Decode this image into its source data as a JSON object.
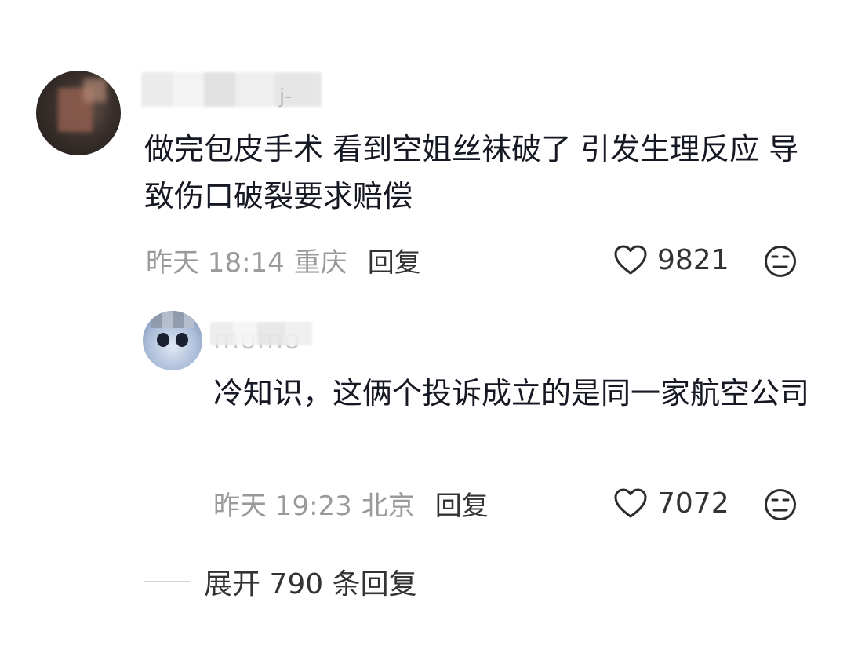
{
  "comment": {
    "username_hint": "j-",
    "text": "做完包皮手术 看到空姐丝袜破了 引发生理反应 导致伤口破裂要求赔偿",
    "time": "昨天 18:14",
    "location": "重庆",
    "reply_label": "回复",
    "likes": "9821",
    "icons": {
      "like": "heart-outline-icon",
      "dislike": "unamused-face-icon"
    }
  },
  "reply": {
    "username_hint": "momo",
    "text": "冷知识，这俩个投诉成立的是同一家航空公司",
    "time": "昨天 19:23",
    "location": "北京",
    "reply_label": "回复",
    "likes": "7072",
    "icons": {
      "like": "heart-outline-icon",
      "dislike": "unamused-face-icon"
    }
  },
  "expand": {
    "label": "展开 790 条回复"
  },
  "colors": {
    "text_primary": "#161823",
    "text_secondary": "#9a9a9a",
    "background": "#ffffff"
  }
}
